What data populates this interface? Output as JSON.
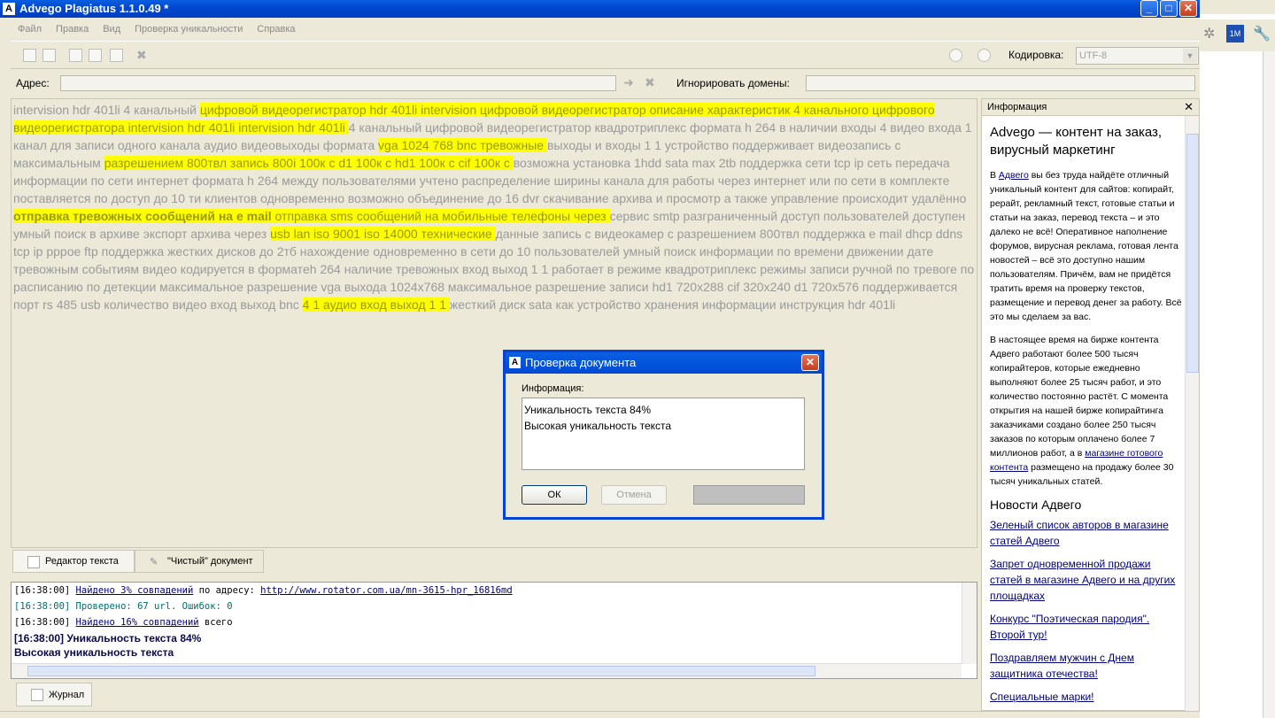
{
  "window": {
    "title": "Advego Plagiatus 1.1.0.49 *",
    "app_icon": "A"
  },
  "menu": [
    "Файл",
    "Правка",
    "Вид",
    "Проверка уникальности",
    "Справка"
  ],
  "toolbar": {
    "encoding_label": "Кодировка:",
    "encoding_value": "UTF-8"
  },
  "address": {
    "label": "Адрес:",
    "value": "",
    "ignore_label": "Игнорировать домены:",
    "ignore_value": ""
  },
  "editor": {
    "segments": [
      {
        "t": "intervision hdr 401li 4 канальный ",
        "h": 0
      },
      {
        "t": "цифровой видеорегистратор hdr 401li intervision цифровой видеорегистратор описание характеристик 4 канального цифрового видеорегистратора intervision hdr 401li intervision hdr 401li ",
        "h": 1
      },
      {
        "t": "4 канальный цифровой видеорегистратор квадротриплекс формата h 264 в наличии входы 4 видео входа 1 канал для записи одного канала аудио видеовыходы формата ",
        "h": 0
      },
      {
        "t": "vga 1024 768 bnc тревожные ",
        "h": 1
      },
      {
        "t": "выходы и входы 1 1 устройство поддерживает видеозапись с максимальным ",
        "h": 0
      },
      {
        "t": "разрешением 800твл запись 800i 100к с d1 100к с hd1 100к с cif 100к с ",
        "h": 1
      },
      {
        "t": "возможна установка 1hdd sata max 2tb поддержка сети tcp ip сеть передача информации по сети интернет формата h 264 между пользователями учтено распределение ширины канала для работы через интернет или по сети в комплекте поставляется по доступ до 10 ти клиентов одновременно возможно объединение до 16 dvr скачивание архива и просмотр а также управление происходит удалённо ",
        "h": 0
      },
      {
        "t": "отправка тревожных сообщений на e mail ",
        "h": 2
      },
      {
        "t": "отправка sms сообщений на мобильные телефоны через ",
        "h": 1
      },
      {
        "t": "сервис smtp разграниченный доступ пользователей доступен умный поиск в архиве экспорт архива через ",
        "h": 0
      },
      {
        "t": "usb lan iso 9001 iso 14000 технические ",
        "h": 1
      },
      {
        "t": "данные запись с видеокамер с разрешением 800твл поддержка e mail dhcp ddns tcp ip pppoe ftp поддержка жестких дисков до 2тб нахождение одновременно в сети до 10 пользователей умный поиск информации по времени движении дате тревожным событиям видео кодируется в форматeh 264 наличие тревожных вход выход 1 1 работает в режиме квадротриплекс режимы записи ручной по тревоге по расписанию по детекции максимальное разрешение vga выхода 1024x768 максимальное разрешение записи hd1 720x288 cif 320x240 d1 720x576 поддерживается порт rs 485 usb количество видео вход выход bnc ",
        "h": 0
      },
      {
        "t": "4 1 аудио вход выход 1 1 ",
        "h": 1
      },
      {
        "t": "жесткий диск sata как устройство хранения информации инструкция hdr 401li",
        "h": 0
      }
    ]
  },
  "tabs": [
    "Редактор текста",
    "\"Чистый\" документ"
  ],
  "info": {
    "header": "Информация",
    "headline": "Advego — контент на заказ, вирусный маркетинг",
    "p1_pre": "В ",
    "p1_link": "Адвего",
    "p1_post": " вы без труда найдёте отличный уникальный контент для сайтов: копирайт, рерайт, рекламный текст, готовые статьи и статьи на заказ, перевод текста – и это далеко не всё! Оперативное наполнение форумов, вирусная реклама, готовая лента новостей – всё это доступно нашим пользователям. Причём, вам не придётся тратить время на проверку текстов, размещение и перевод денег за работу. Всё это мы сделаем за вас.",
    "p2_pre": "В настоящее время на бирже контента Адвего работают более 500 тысяч копирайтеров, которые ежедневно выполняют более 25 тысяч работ, и это количество постоянно растёт. С момента открытия на нашей бирже копирайтинга заказчиками создано более 250 тысяч заказов по которым оплачено более 7 миллионов работ, а в ",
    "p2_link": "магазине готового контента",
    "p2_post": " размещено на продажу более 30 тысяч уникальных статей.",
    "news_title": "Новости Адвего",
    "news": [
      "Зеленый список авторов в магазине статей Адвего",
      "Запрет одновременной продажи статей в магазине Адвего и на других площадках",
      "Конкурс \"Поэтическая пародия\". Второй тур!",
      "Поздравляем мужчин с Днем защитника отечества!",
      "Специальные марки!"
    ]
  },
  "log": {
    "l1_time": "[16:38:00]",
    "l1_link": "Найдено 3% совпадений",
    "l1_mid": " по адресу: ",
    "l1_url": "http://www.rotator.com.ua/mn-3615-hpr_16816md",
    "l2": "[16:38:00] Проверено: 67 url. Ошибок: 0",
    "l3_time": "[16:38:00]",
    "l3_link": "Найдено 16% совпадений",
    "l3_post": "  всего",
    "l4": "[16:38:00] Уникальность текста 84%",
    "l5": "Высокая уникальность текста"
  },
  "journal_tab": "Журнал",
  "dialog": {
    "title": "Проверка документа",
    "label": "Информация:",
    "line1": "Уникальность текста 84%",
    "line2": "Высокая уникальность текста",
    "ok": "ОК",
    "cancel": "Отмена"
  },
  "colors": {
    "highlight": "#ffff00",
    "titlebar": "#0a5fe0",
    "link": "#00007a"
  }
}
